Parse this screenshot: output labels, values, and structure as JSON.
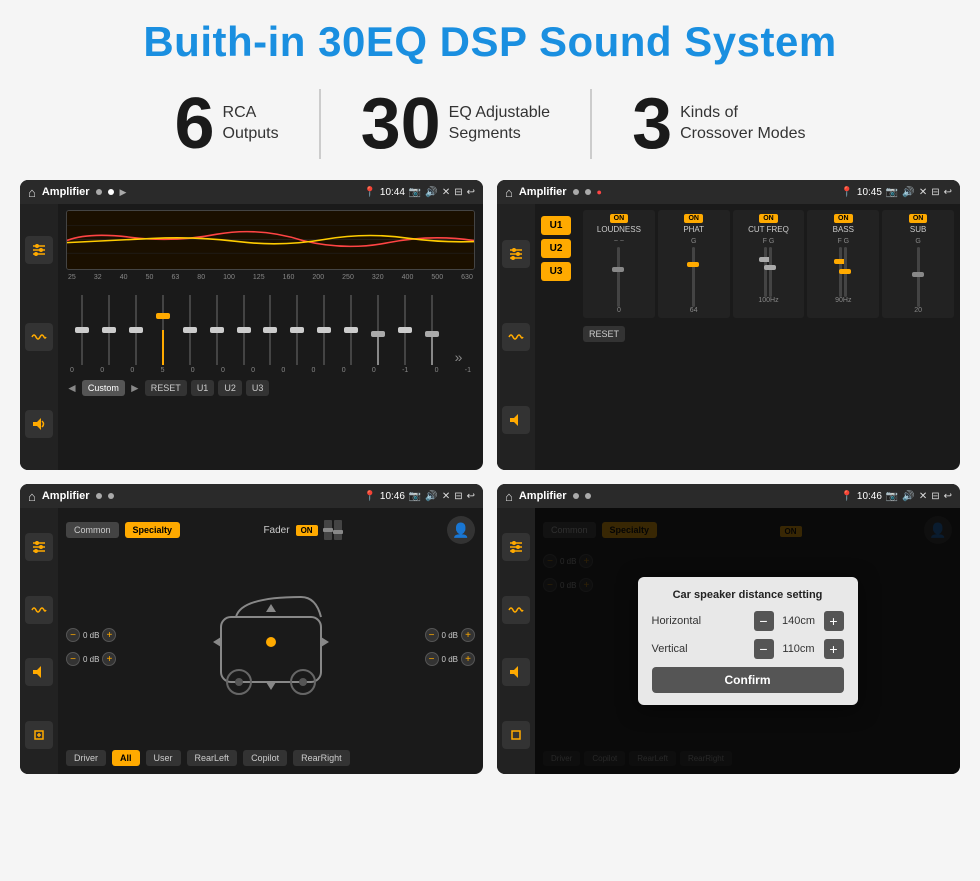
{
  "page": {
    "title": "Buith-in 30EQ DSP Sound System",
    "bg_color": "#f5f5f5"
  },
  "stats": [
    {
      "number": "6",
      "label_line1": "RCA",
      "label_line2": "Outputs"
    },
    {
      "number": "30",
      "label_line1": "EQ Adjustable",
      "label_line2": "Segments"
    },
    {
      "number": "3",
      "label_line1": "Kinds of",
      "label_line2": "Crossover Modes"
    }
  ],
  "screens": [
    {
      "id": "eq-screen",
      "title": "EQ Sliders",
      "app": "Amplifier",
      "time": "10:44",
      "freq_labels": [
        "25",
        "32",
        "40",
        "50",
        "63",
        "80",
        "100",
        "125",
        "160",
        "200",
        "250",
        "320",
        "400",
        "500",
        "630"
      ],
      "eq_values": [
        "0",
        "0",
        "0",
        "5",
        "0",
        "0",
        "0",
        "0",
        "0",
        "0",
        "0",
        "-1",
        "0",
        "-1"
      ],
      "preset": "Custom",
      "buttons": [
        "RESET",
        "U1",
        "U2",
        "U3"
      ]
    },
    {
      "id": "crossover-screen",
      "title": "Crossover Settings",
      "app": "Amplifier",
      "time": "10:45",
      "u_buttons": [
        "U1",
        "U2",
        "U3"
      ],
      "columns": [
        "LOUDNESS",
        "PHAT",
        "CUT FREQ",
        "BASS",
        "SUB"
      ],
      "reset_btn": "RESET"
    },
    {
      "id": "fader-screen",
      "title": "Fader Settings",
      "app": "Amplifier",
      "time": "10:46",
      "mode_buttons": [
        "Common",
        "Specialty"
      ],
      "active_mode": "Specialty",
      "fader_label": "Fader",
      "on_label": "ON",
      "volume_values": [
        "0 dB",
        "0 dB",
        "0 dB",
        "0 dB"
      ],
      "bottom_buttons": [
        "Driver",
        "All",
        "User",
        "RearLeft",
        "Copilot",
        "RearRight"
      ],
      "active_bottom": "All"
    },
    {
      "id": "distance-screen",
      "title": "Car Speaker Distance Setting",
      "app": "Amplifier",
      "time": "10:46",
      "mode_buttons": [
        "Common",
        "Specialty"
      ],
      "dialog": {
        "title": "Car speaker distance setting",
        "horizontal_label": "Horizontal",
        "horizontal_value": "140cm",
        "vertical_label": "Vertical",
        "vertical_value": "110cm",
        "confirm_label": "Confirm"
      },
      "volume_values": [
        "0 dB",
        "0 dB"
      ],
      "bottom_buttons": [
        "Driver",
        "Copilot",
        "RearLeft",
        "RearRight"
      ]
    }
  ]
}
